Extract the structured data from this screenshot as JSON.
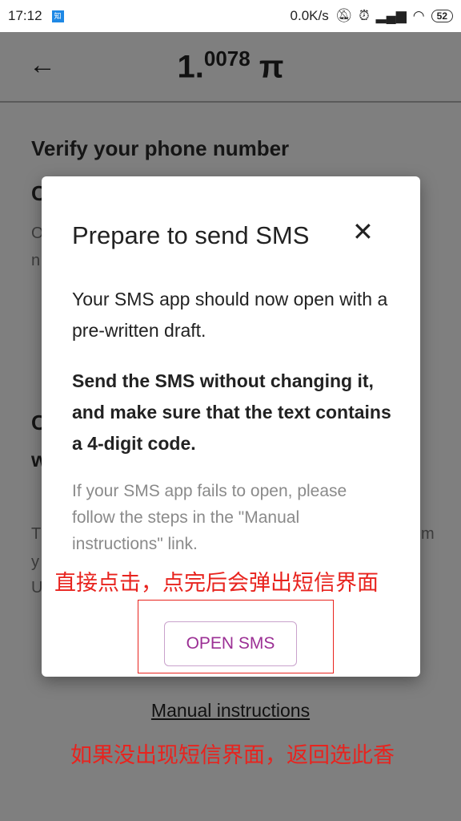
{
  "status_bar": {
    "time": "17:12",
    "app_icon": "知",
    "net_speed": "0.0K/s",
    "icons": [
      "mute-icon",
      "alarm-icon",
      "signal-icon",
      "wifi-icon"
    ],
    "battery": "52"
  },
  "app_bar": {
    "back_icon": "←",
    "balance_main": "1.",
    "balance_decimals": "0078",
    "currency": "π"
  },
  "background": {
    "heading": "Verify your phone number",
    "fragments": [
      "C",
      "O",
      "n",
      "C",
      "w",
      "T",
      "y",
      "U",
      "m"
    ]
  },
  "modal": {
    "title": "Prepare to send SMS",
    "close_icon": "✕",
    "paragraph1": "Your SMS app should now open with a pre-written draft.",
    "paragraph2": "Send the SMS without changing it, and make sure that the text contains a 4-digit code.",
    "paragraph3": "If your SMS app fails to open, please follow the steps in the \"Manual instructions\" link.",
    "open_button": "OPEN SMS"
  },
  "manual_link": "Manual instructions",
  "annotations": {
    "top": "直接点击，点完后会弹出短信界面",
    "bottom": "如果没出现短信界面，返回选此香",
    "color": "#e8231e"
  },
  "colors": {
    "accent": "#9b2f94",
    "overlay": "#7f7f7f"
  }
}
